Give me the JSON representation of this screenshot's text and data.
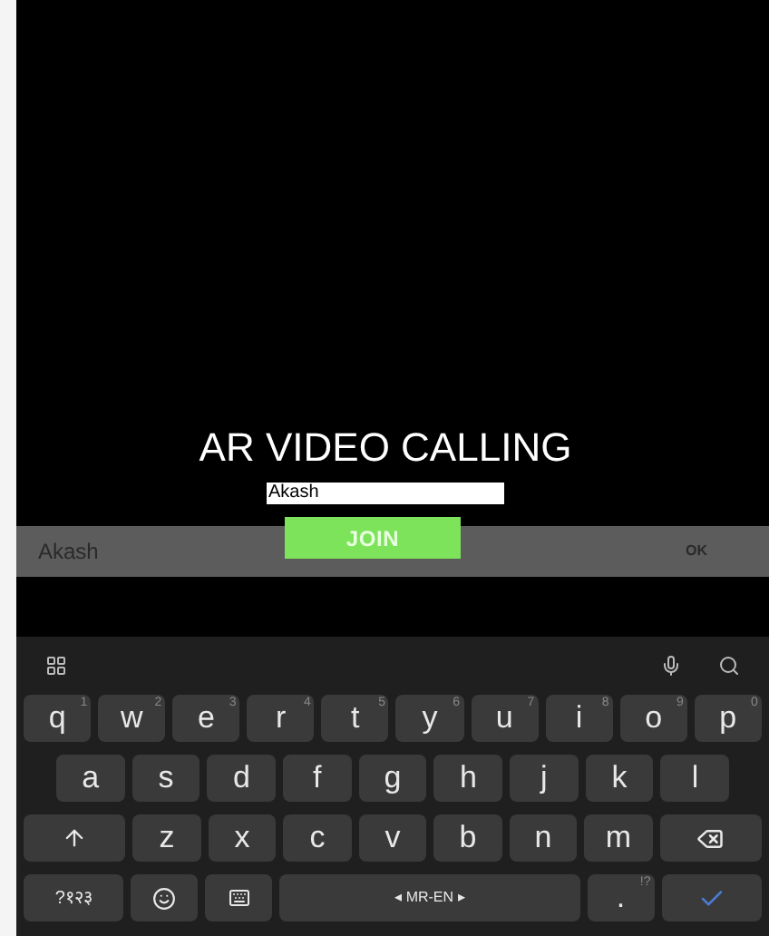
{
  "app": {
    "title": "AR VIDEO CALLING",
    "name_field": {
      "value": "Akash"
    },
    "join_button": "JOIN"
  },
  "input_bar": {
    "text": "Akash",
    "action": "OK"
  },
  "keyboard": {
    "rows": [
      [
        {
          "kind": "letter",
          "label": "q",
          "hint": "1"
        },
        {
          "kind": "letter",
          "label": "w",
          "hint": "2"
        },
        {
          "kind": "letter",
          "label": "e",
          "hint": "3"
        },
        {
          "kind": "letter",
          "label": "r",
          "hint": "4"
        },
        {
          "kind": "letter",
          "label": "t",
          "hint": "5"
        },
        {
          "kind": "letter",
          "label": "y",
          "hint": "6"
        },
        {
          "kind": "letter",
          "label": "u",
          "hint": "7"
        },
        {
          "kind": "letter",
          "label": "i",
          "hint": "8"
        },
        {
          "kind": "letter",
          "label": "o",
          "hint": "9"
        },
        {
          "kind": "letter",
          "label": "p",
          "hint": "0"
        }
      ],
      [
        {
          "kind": "letter",
          "label": "a"
        },
        {
          "kind": "letter",
          "label": "s"
        },
        {
          "kind": "letter",
          "label": "d"
        },
        {
          "kind": "letter",
          "label": "f"
        },
        {
          "kind": "letter",
          "label": "g"
        },
        {
          "kind": "letter",
          "label": "h"
        },
        {
          "kind": "letter",
          "label": "j"
        },
        {
          "kind": "letter",
          "label": "k"
        },
        {
          "kind": "letter",
          "label": "l"
        }
      ],
      [
        {
          "kind": "shift"
        },
        {
          "kind": "letter",
          "label": "z"
        },
        {
          "kind": "letter",
          "label": "x"
        },
        {
          "kind": "letter",
          "label": "c"
        },
        {
          "kind": "letter",
          "label": "v"
        },
        {
          "kind": "letter",
          "label": "b"
        },
        {
          "kind": "letter",
          "label": "n"
        },
        {
          "kind": "letter",
          "label": "m"
        },
        {
          "kind": "backspace"
        }
      ],
      [
        {
          "kind": "symbols",
          "label": "?१२३"
        },
        {
          "kind": "emoji"
        },
        {
          "kind": "settings"
        },
        {
          "kind": "space",
          "label": "◂ MR-EN ▸"
        },
        {
          "kind": "letter",
          "label": ".",
          "hint": "!?"
        },
        {
          "kind": "enter"
        }
      ]
    ]
  }
}
